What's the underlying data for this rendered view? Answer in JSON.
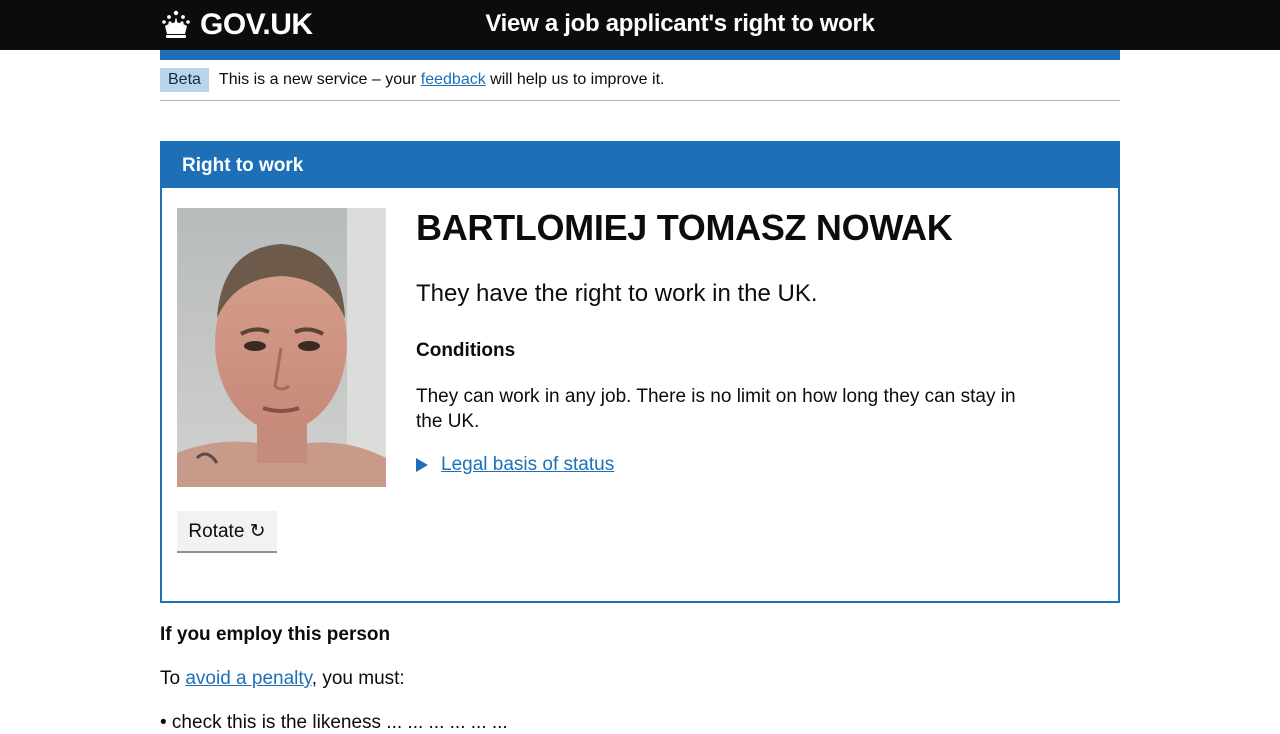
{
  "header": {
    "logo_text": "GOV.UK",
    "service_name": "View a job applicant's right to work"
  },
  "phase_banner": {
    "tag": "Beta",
    "text_before": "This is a new service – your ",
    "link_text": "feedback",
    "text_after": " will help us to improve it."
  },
  "card": {
    "header": "Right to work",
    "photo_alt": "Photo of BARTLOMIEJ TOMASZ NOWAK",
    "rotate_button": "Rotate ↻",
    "name": "BARTLOMIEJ TOMASZ NOWAK",
    "status": "They have the right to work in the UK.",
    "conditions_heading": "Conditions",
    "conditions_text": "They can work in any job. There is no limit on how long they can stay in the UK.",
    "details_summary": "Legal basis of status"
  },
  "employ": {
    "heading": "If you employ this person",
    "text_before": "To ",
    "link_text": "avoid a penalty",
    "text_after": ", you must:",
    "cut_off_item": "• check this is the likeness ... ... ... ... ... ..."
  },
  "colors": {
    "header_bg": "#0b0c0c",
    "brand_blue": "#1d70b8",
    "beta_tag_bg": "#bbd4ea",
    "button_bg": "#f3f2f1"
  }
}
